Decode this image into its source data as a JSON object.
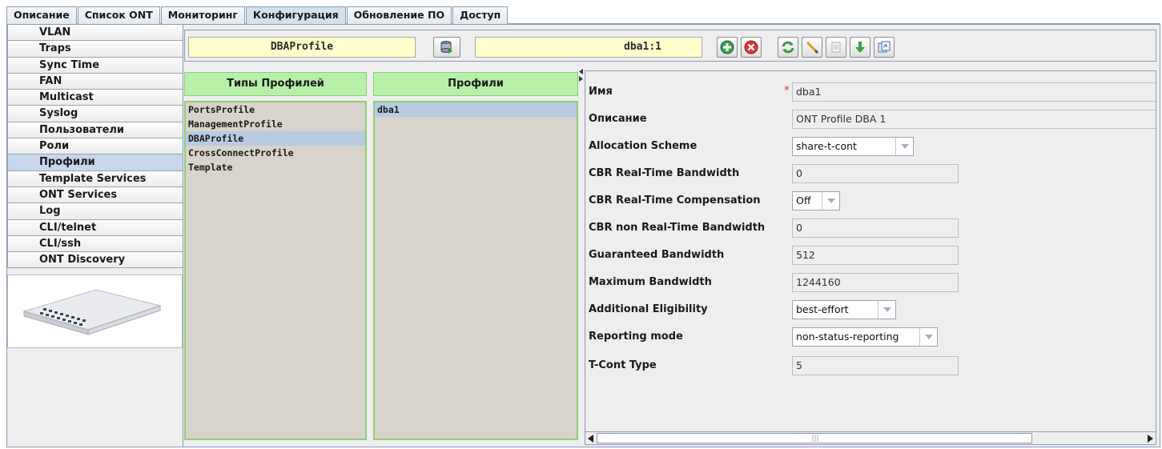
{
  "tabs": [
    "Описание",
    "Список ONT",
    "Мониторинг",
    "Конфигурация",
    "Обновление ПО",
    "Доступ"
  ],
  "active_tab": "Конфигурация",
  "nav": {
    "items": [
      "VLAN",
      "Traps",
      "Sync Time",
      "FAN",
      "Multicast",
      "Syslog",
      "Пользователи",
      "Роли",
      "Профили",
      "Template Services",
      "ONT Services",
      "Log",
      "CLI/telnet",
      "CLI/ssh",
      "ONT Discovery"
    ],
    "active": "Профили"
  },
  "toolbar": {
    "profile_type_value": "DBAProfile",
    "profile_value": "dba1:1",
    "icons": [
      "database-icon",
      "add-icon",
      "delete-icon",
      "refresh-icon",
      "edit-icon",
      "copy-icon",
      "download-icon",
      "export-icon"
    ]
  },
  "profile_types": {
    "header": "Типы Профилей",
    "items": [
      "PortsProfile",
      "ManagementProfile",
      "DBAProfile",
      "CrossConnectProfile",
      "Template"
    ],
    "selected": "DBAProfile"
  },
  "profiles": {
    "header": "Профили",
    "items": [
      "dba1"
    ],
    "selected": "dba1"
  },
  "properties": {
    "name": {
      "label": "Имя",
      "value": "dba1",
      "required": "*"
    },
    "description": {
      "label": "Описание",
      "value": "ONT Profile DBA 1"
    },
    "allocation_scheme": {
      "label": "Allocation Scheme",
      "value": "share-t-cont"
    },
    "cbr_rt_bandwidth": {
      "label": "CBR Real-Time Bandwidth",
      "value": "0"
    },
    "cbr_rt_compensation": {
      "label": "CBR Real-Time Compensation",
      "value": "Off"
    },
    "cbr_nrt_bandwidth": {
      "label": "CBR non Real-Time Bandwidth",
      "value": "0"
    },
    "guaranteed_bandwidth": {
      "label": "Guaranteed Bandwidth",
      "value": "512"
    },
    "maximum_bandwidth": {
      "label": "Maximum Bandwidth",
      "value": "1244160"
    },
    "additional_eligibility": {
      "label": "Additional Eligibility",
      "value": "best-effort"
    },
    "reporting_mode": {
      "label": "Reporting mode",
      "value": "non-status-reporting"
    },
    "tcont_type": {
      "label": "T-Cont Type",
      "value": "5"
    }
  },
  "colors": {
    "header_green": "#b7f0a7",
    "field_yellow": "#ffffcc",
    "list_bg": "#d8d3cb",
    "selection": "#b8cbe2"
  }
}
